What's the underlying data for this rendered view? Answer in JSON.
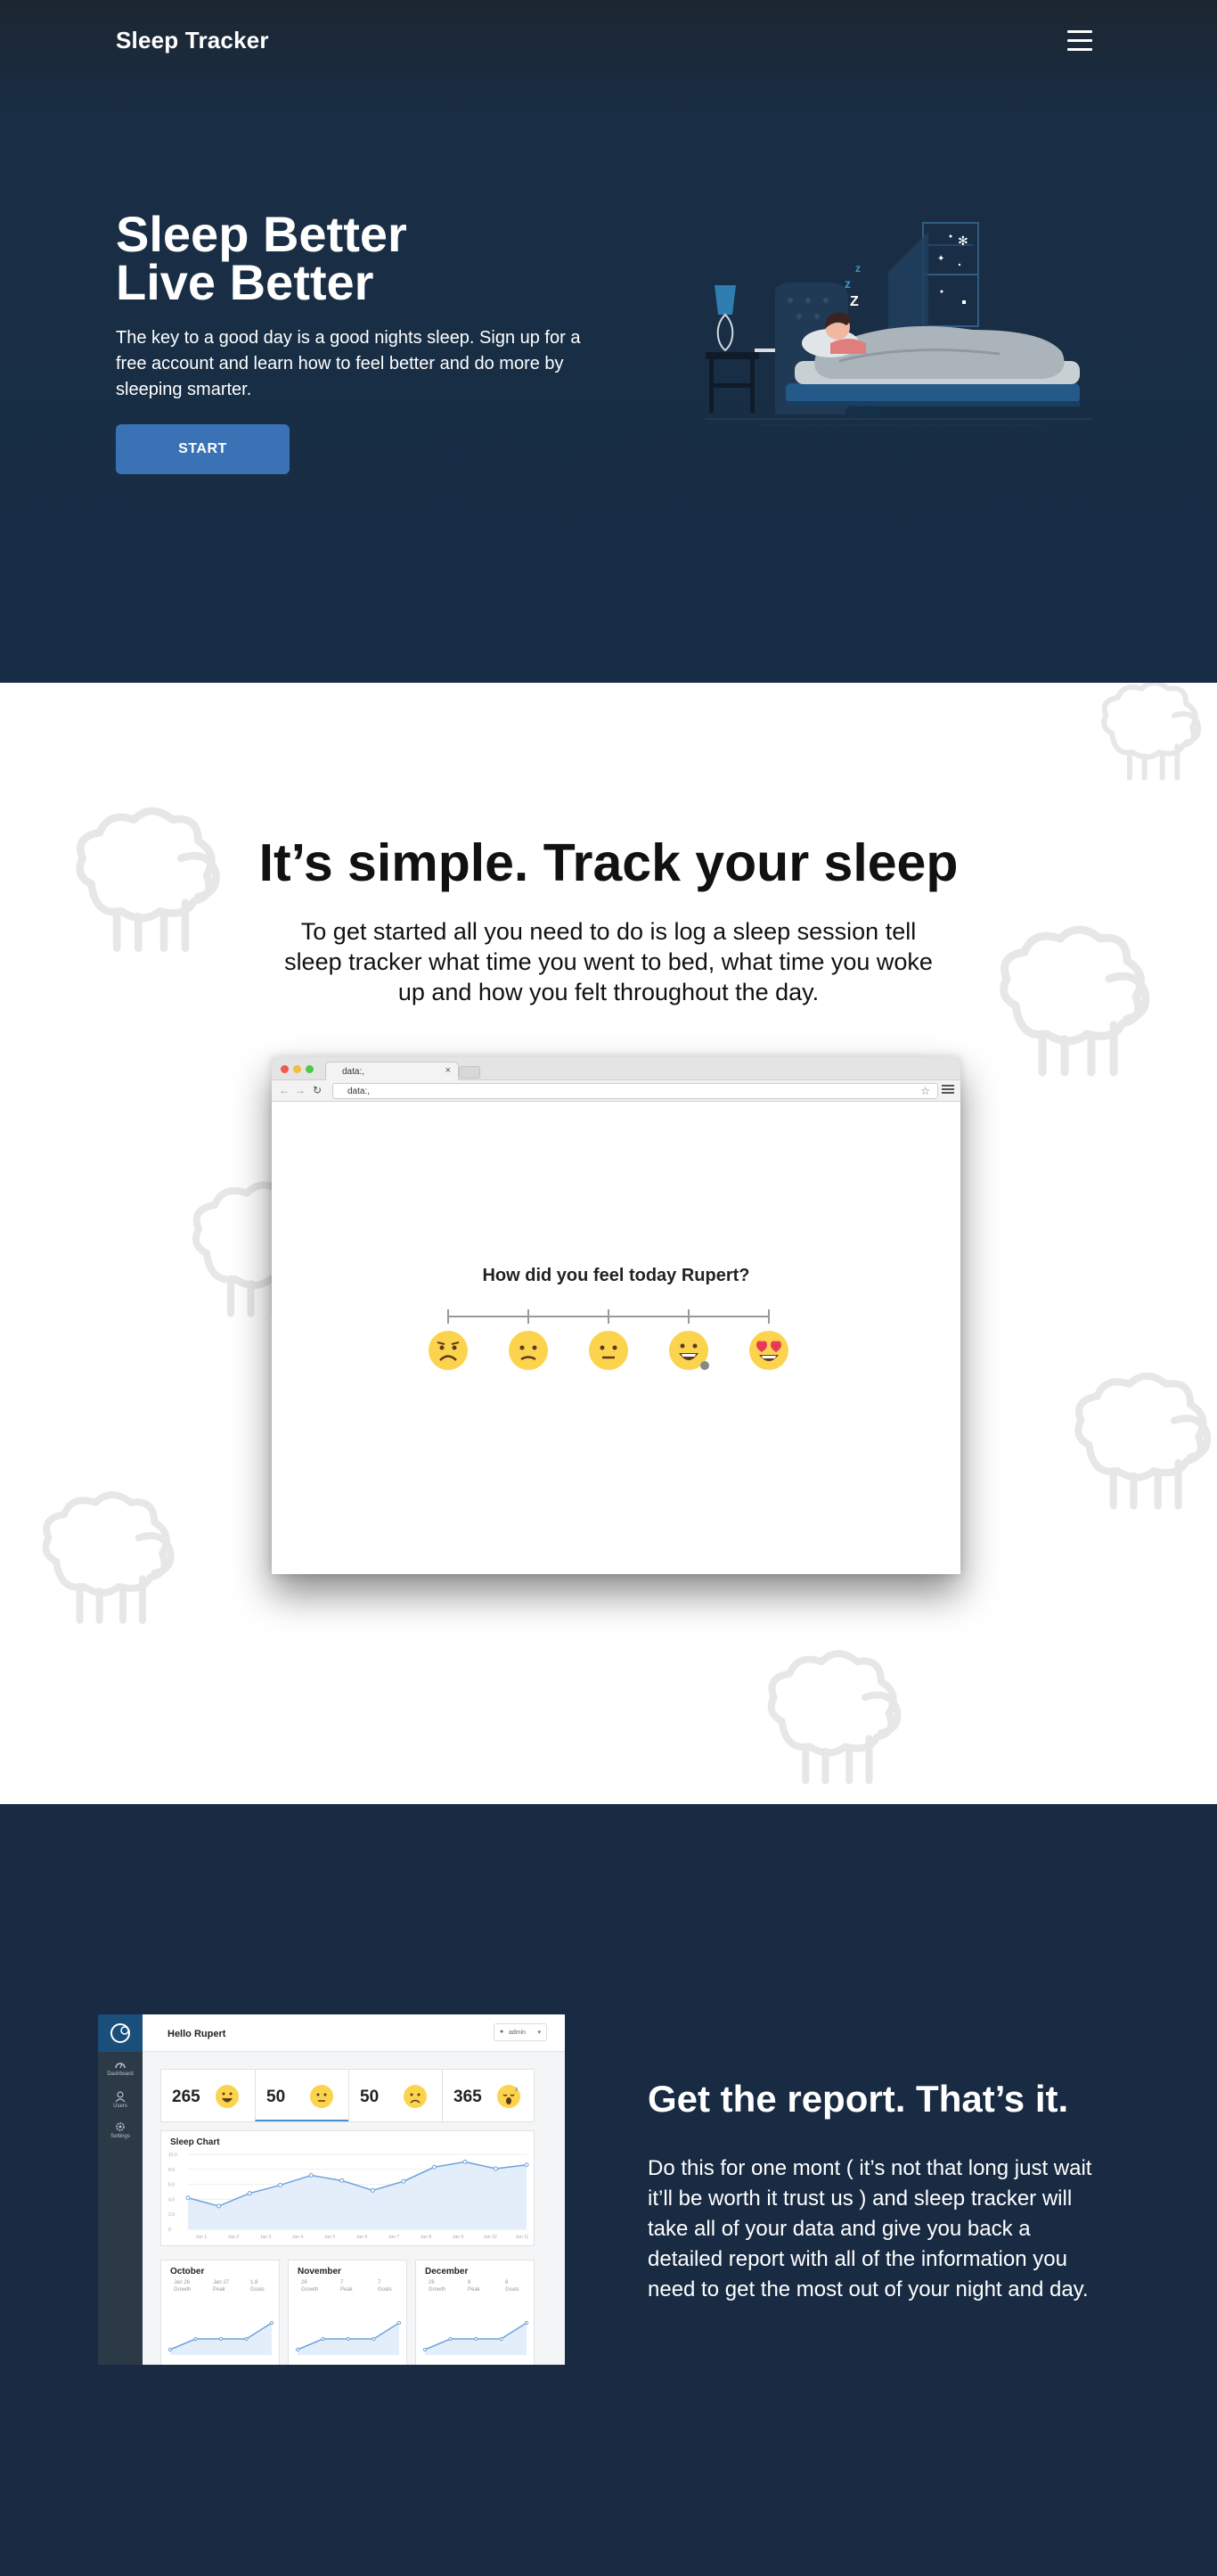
{
  "nav": {
    "brand": "Sleep Tracker",
    "menu_icon": "hamburger-menu-icon"
  },
  "hero": {
    "title_line1": "Sleep Better",
    "title_line2": "Live Better",
    "subtitle": "The key to a good day is a good nights sleep. Sign up for a free account and learn how to feel better and do more by sleeping smarter.",
    "cta_label": "START",
    "zzz": [
      "z",
      "z",
      "Z"
    ]
  },
  "simple": {
    "title": "It’s simple. Track your sleep",
    "subtitle": "To get started all you need to do is log a sleep session tell sleep tracker what time you went to bed, what time you woke up and how you felt throughout the day."
  },
  "browser": {
    "tab_title": "data:,",
    "tab_close": "×",
    "url": "data:,",
    "back_icon": "←",
    "forward_icon": "→",
    "reload_icon": "↻",
    "star_icon": "☆",
    "question": "How did you feel today Rupert?",
    "moods": [
      "very-sad-face-icon",
      "sad-face-icon",
      "neutral-face-icon",
      "happy-face-icon",
      "heart-eyes-face-icon"
    ]
  },
  "report": {
    "title": "Get the report. That’s it.",
    "subtitle": "Do this for one mont ( it’s not that long just wait it’ll be worth it trust us ) and sleep tracker will take all of your data and give you back a detailed report with all of the information you need to get the most out of your night and day."
  },
  "dashboard": {
    "greeting": "Hello Rupert",
    "user_label": "admin",
    "sidebar": [
      {
        "label": "Dashboard",
        "icon": "speedometer-icon"
      },
      {
        "label": "Users",
        "icon": "user-icon"
      },
      {
        "label": "Settings",
        "icon": "gear-icon"
      }
    ],
    "stats": [
      {
        "value": "265",
        "icon": "happy-face-icon"
      },
      {
        "value": "50",
        "icon": "neutral-face-icon"
      },
      {
        "value": "50",
        "icon": "sad-face-icon"
      },
      {
        "value": "365",
        "icon": "sleepy-face-icon"
      }
    ],
    "chart_title": "Sleep Chart",
    "chart_x_labels": [
      "Jan 1",
      "Jan 2",
      "Jan 3",
      "Jan 4",
      "Jan 5",
      "Jan 6",
      "Jan 7",
      "Jan 8",
      "Jan 9",
      "Jan 10",
      "Jan 11"
    ],
    "chart_y_labels": [
      "10.0",
      "8.0",
      "6.0",
      "4.0",
      "2.0",
      "0"
    ],
    "chart_values": [
      4.2,
      3.1,
      4.8,
      5.9,
      7.2,
      6.5,
      5.2,
      6.4,
      8.3,
      9.0,
      8.1,
      8.6
    ],
    "months": [
      {
        "name": "October",
        "cols": [
          "Jan 26",
          "Jan 27",
          "1.8"
        ],
        "col_labels": [
          "Growth",
          "Peak",
          "Goals"
        ],
        "values": [
          1,
          3,
          3,
          3,
          6
        ]
      },
      {
        "name": "November",
        "cols": [
          "26",
          "7",
          "7"
        ],
        "col_labels": [
          "Growth",
          "Peak",
          "Goals"
        ],
        "values": [
          1,
          3,
          3,
          3,
          6
        ]
      },
      {
        "name": "December",
        "cols": [
          "26",
          "8",
          "8"
        ],
        "col_labels": [
          "Growth",
          "Peak",
          "Goals"
        ],
        "values": [
          1,
          3,
          3,
          3,
          6
        ]
      }
    ],
    "colors": {
      "sidebar": "#2c3a47",
      "accent": "#1b4f7b",
      "line": "#6fa3db"
    }
  },
  "colors": {
    "hero_bg": "#182d45",
    "cta": "#3b72b6",
    "report_bg": "#182b43"
  }
}
